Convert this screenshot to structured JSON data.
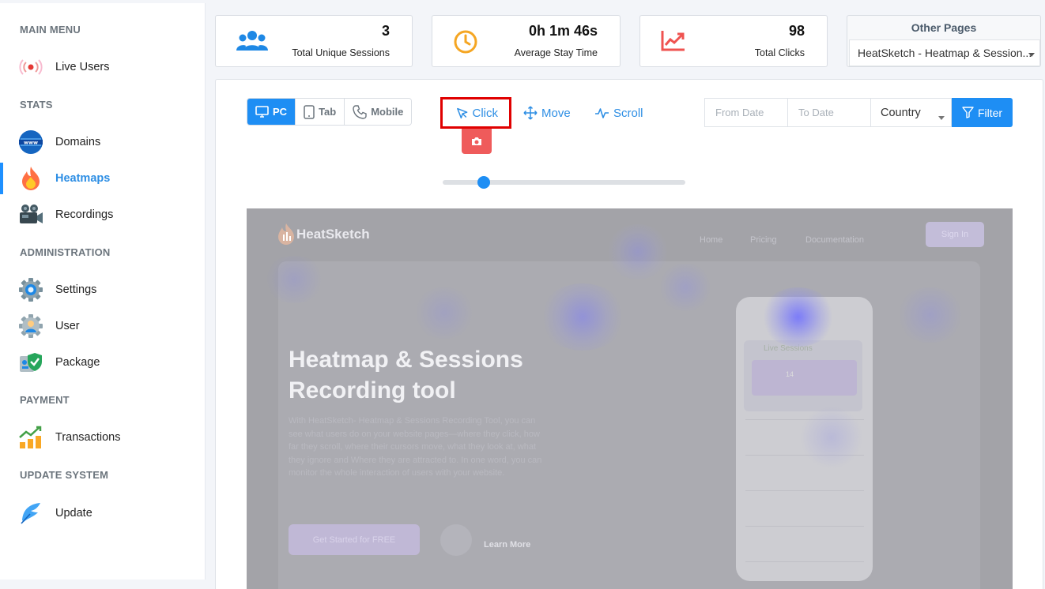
{
  "sidebar": {
    "sections": {
      "main_menu": "MAIN MENU",
      "stats": "STATS",
      "administration": "ADMINISTRATION",
      "payment": "PAYMENT",
      "update_system": "UPDATE SYSTEM"
    },
    "items": [
      {
        "label": "Live Users",
        "icon": "live-signal-icon"
      },
      {
        "label": "Domains",
        "icon": "www-globe-icon"
      },
      {
        "label": "Heatmaps",
        "icon": "fire-icon",
        "active": true
      },
      {
        "label": "Recordings",
        "icon": "video-camera-icon"
      },
      {
        "label": "Settings",
        "icon": "gear-icon"
      },
      {
        "label": "User",
        "icon": "user-gear-icon"
      },
      {
        "label": "Package",
        "icon": "shield-check-icon"
      },
      {
        "label": "Transactions",
        "icon": "growth-chart-icon"
      },
      {
        "label": "Update",
        "icon": "feather-icon"
      }
    ]
  },
  "stats": [
    {
      "value": "3",
      "caption": "Total Unique Sessions",
      "icon": "users-icon",
      "color": "#1e88e5"
    },
    {
      "value": "0h 1m 46s",
      "caption": "Average Stay Time",
      "icon": "clock-icon",
      "color": "#f5a623"
    },
    {
      "value": "98",
      "caption": "Total Clicks",
      "icon": "trend-chart-icon",
      "color": "#ef5350"
    }
  ],
  "other_pages": {
    "title": "Other Pages",
    "selected": "HeatSketch - Heatmap & Session..."
  },
  "toolbar": {
    "devices": [
      "PC",
      "Tab",
      "Mobile"
    ],
    "active_device": "PC",
    "modes": [
      "Click",
      "Move",
      "Scroll"
    ],
    "active_mode": "Click",
    "from_date_placeholder": "From Date",
    "to_date_placeholder": "To Date",
    "country": "Country",
    "filter_label": "Filter",
    "slider_value": 0.15
  },
  "preview": {
    "logo": "HeatSketch",
    "nav": [
      "Home",
      "Pricing",
      "Documentation"
    ],
    "sign_in": "Sign In",
    "headline": "Heatmap & Sessions Recording tool",
    "paragraph": "With HeatSketch- Heatmap & Sessions Recording Tool, you can see what users do on your website pages—where they click, how far they scroll, where their cursors move, what they look at, what they ignore and Where they are attracted to. In one word, you can monitor the whole interaction of users with your website.",
    "cta": "Get Started for FREE",
    "learn_more": "Learn More",
    "phone_panel_title": "Live Sessions",
    "phone_panel_count": "14"
  },
  "colors": {
    "primary": "#1e8ef4",
    "active_text": "#2d8ee4",
    "highlight_border": "#e00000",
    "camera_button": "#ef5b5b"
  }
}
